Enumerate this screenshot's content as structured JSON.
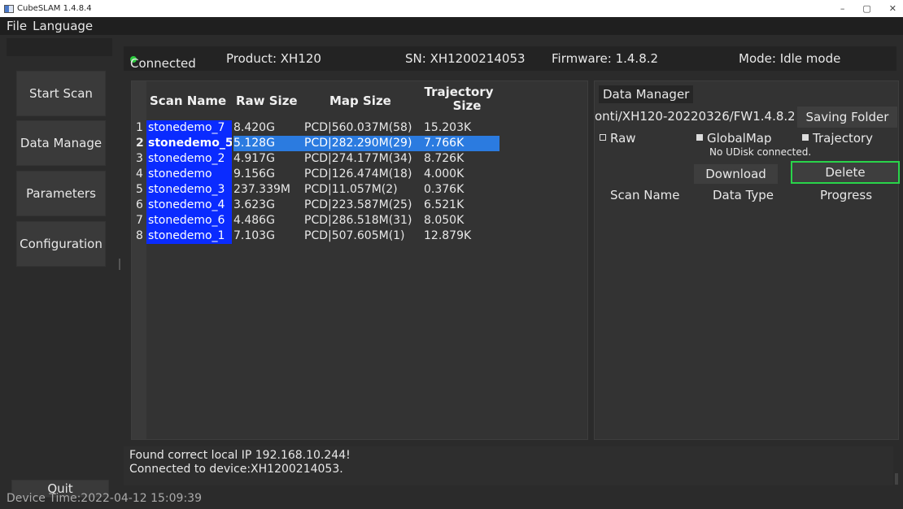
{
  "window": {
    "title": "CubeSLAM 1.4.8.4",
    "minimize": "–",
    "maximize": "▢",
    "close": "✕"
  },
  "menu": {
    "file": "File",
    "language": "Language"
  },
  "nav": {
    "start_scan": "Start Scan",
    "data_manage": "Data Manage",
    "parameters": "Parameters",
    "configuration": "Configuration",
    "quit": "Quit"
  },
  "status": {
    "connected": "Connected",
    "product": "Product: XH120",
    "sn": "SN: XH1200214053",
    "firmware": "Firmware: 1.4.8.2",
    "mode": "Mode: Idle mode",
    "connected_color": "#2ecc40"
  },
  "scan_table": {
    "headers": {
      "name": "Scan Name",
      "raw": "Raw Size",
      "map": "Map Size",
      "traj_line1": "Trajectory",
      "traj_line2": "Size"
    },
    "rows": [
      {
        "num": "1",
        "name": "stonedemo_7",
        "raw": "8.420G",
        "map": "PCD|560.037M(58)",
        "traj": "15.203K"
      },
      {
        "num": "2",
        "name": "stonedemo_5",
        "raw": "5.128G",
        "map": "PCD|282.290M(29)",
        "traj": "7.766K"
      },
      {
        "num": "3",
        "name": "stonedemo_2",
        "raw": "4.917G",
        "map": "PCD|274.177M(34)",
        "traj": "8.726K"
      },
      {
        "num": "4",
        "name": "stonedemo",
        "raw": "9.156G",
        "map": "PCD|126.474M(18)",
        "traj": "4.000K"
      },
      {
        "num": "5",
        "name": "stonedemo_3",
        "raw": "237.339M",
        "map": "PCD|11.057M(2)",
        "traj": "0.376K"
      },
      {
        "num": "6",
        "name": "stonedemo_4",
        "raw": "3.623G",
        "map": "PCD|223.587M(25)",
        "traj": "6.521K"
      },
      {
        "num": "7",
        "name": "stonedemo_6",
        "raw": "4.486G",
        "map": "PCD|286.518M(31)",
        "traj": "8.050K"
      },
      {
        "num": "8",
        "name": "stonedemo_1",
        "raw": "7.103G",
        "map": "PCD|507.605M(1)",
        "traj": "12.879K"
      }
    ]
  },
  "data_manager": {
    "tab": "Data Manager",
    "path": "onti/XH120-20220326/FW1.4.8.2",
    "saving_folder": "Saving Folder",
    "raw": "Raw",
    "global_map": "GlobalMap",
    "trajectory": "Trajectory",
    "udisk": "No UDisk connected.",
    "download": "Download",
    "delete": "Delete",
    "col_scan_name": "Scan Name",
    "col_data_type": "Data Type",
    "col_progress": "Progress"
  },
  "log": {
    "line1": "Found correct local IP 192.168.10.244!",
    "line2": "Connected to device:XH1200214053."
  },
  "device_time": "Device Time:2022-04-12 15:09:39"
}
